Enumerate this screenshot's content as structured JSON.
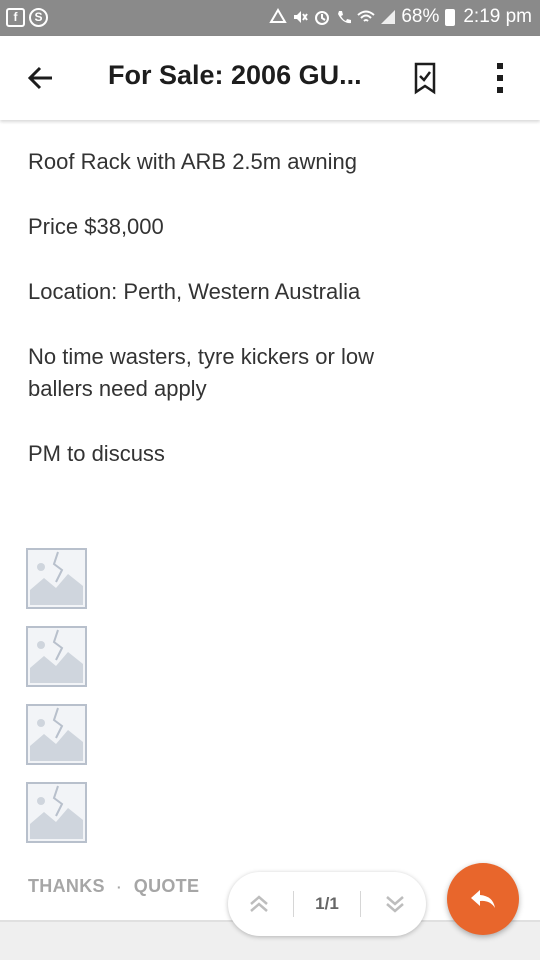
{
  "status_bar": {
    "left_icons": [
      "facebook-icon",
      "skype-icon"
    ],
    "battery": "68%",
    "time": "2:19 pm"
  },
  "app_bar": {
    "title": "For Sale: 2006 GU...",
    "back_icon": "arrow-left-icon",
    "bookmark_icon": "bookmark-check-icon",
    "more_icon": "more-vert-icon"
  },
  "post": {
    "lines": [
      "Roof Rack with ARB 2.5m awning",
      "Price $38,000",
      "Location: Perth, Western Australia",
      "No time wasters, tyre kickers or low ballers need apply",
      "PM to discuss"
    ],
    "image_count": 4
  },
  "actions": {
    "thanks": "THANKS",
    "separator": "·",
    "quote": "QUOTE"
  },
  "pager": {
    "page": "1/1"
  },
  "colors": {
    "accent": "#e8662c",
    "status_bar": "#8a8a8a"
  }
}
